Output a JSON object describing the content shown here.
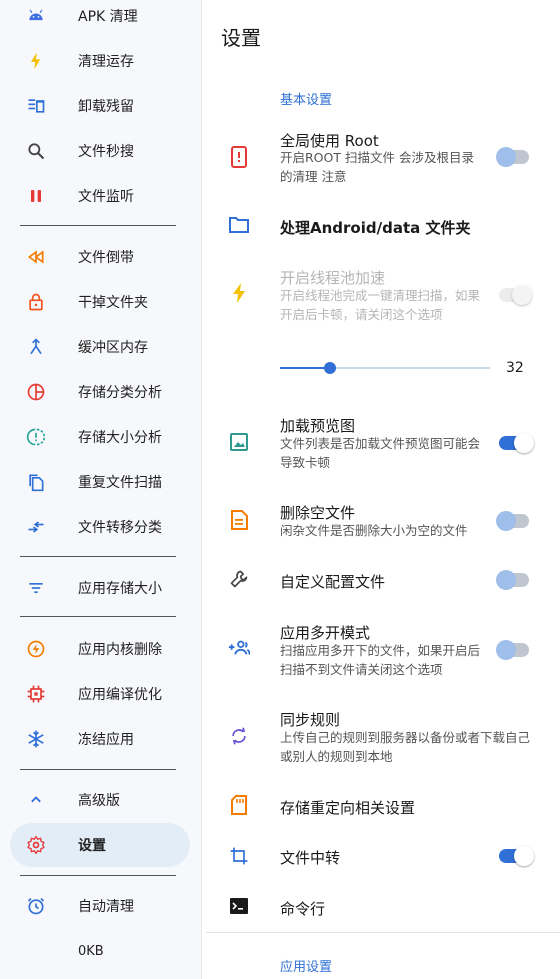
{
  "sidebar": {
    "items": [
      {
        "label": "APK 清理",
        "icon": "android-icon",
        "color": "#3d6fe0"
      },
      {
        "label": "清理运存",
        "icon": "lightning-icon",
        "color": "#f2c200"
      },
      {
        "label": "卸载残留",
        "icon": "uninstall-icon",
        "color": "#2f6fd6"
      },
      {
        "label": "文件秒搜",
        "icon": "search-icon",
        "color": "#444444"
      },
      {
        "label": "文件监听",
        "icon": "pause-icon",
        "color": "#e53935"
      },
      {
        "label": "文件倒带",
        "icon": "rewind-icon",
        "color": "#f57c00"
      },
      {
        "label": "干掉文件夹",
        "icon": "lock-icon",
        "color": "#f4511e"
      },
      {
        "label": "缓冲区内存",
        "icon": "merge-icon",
        "color": "#2f6fd6"
      },
      {
        "label": "存储分类分析",
        "icon": "pie-chart-icon",
        "color": "#e53935"
      },
      {
        "label": "存储大小分析",
        "icon": "data-usage-icon",
        "color": "#26a69a"
      },
      {
        "label": "重复文件扫描",
        "icon": "copy-icon",
        "color": "#2f6fd6"
      },
      {
        "label": "文件转移分类",
        "icon": "transfer-icon",
        "color": "#2f6fd6"
      },
      {
        "label": "应用存储大小",
        "icon": "filter-icon",
        "color": "#2f6fd6"
      },
      {
        "label": "应用内核删除",
        "icon": "power-bolt-icon",
        "color": "#f57c00"
      },
      {
        "label": "应用编译优化",
        "icon": "chip-icon",
        "color": "#e53935"
      },
      {
        "label": "冻结应用",
        "icon": "snowflake-icon",
        "color": "#2f6fd6"
      },
      {
        "label": "高级版",
        "icon": "chevron-up-icon",
        "color": "#2f6fd6"
      },
      {
        "label": "设置",
        "icon": "gear-icon",
        "color": "#e53935",
        "active": true
      },
      {
        "label": "自动清理",
        "icon": "alarm-icon",
        "color": "#2f6fd6"
      },
      {
        "label": "0KB",
        "icon": "",
        "color": "#222222"
      }
    ]
  },
  "main": {
    "page_title": "设置",
    "section_basic": "基本设置",
    "section_app": "应用设置",
    "rows": {
      "root": {
        "title": "全局使用 Root",
        "subtitle": "开启ROOT 扫描文件 会涉及根目录的清理 注意",
        "icon": "phone-alert-icon",
        "switch": false
      },
      "android_data": {
        "title": "处理Android/data 文件夹",
        "icon": "folder-icon"
      },
      "thread_pool": {
        "title": "开启线程池加速",
        "subtitle": "开启线程池完成一键清理扫描，如果开启后卡顿，请关闭这个选项",
        "icon": "lightning-icon",
        "switch": true,
        "disabled": true
      },
      "slider": {
        "value": "32",
        "fraction": 0.24
      },
      "preview": {
        "title": "加载预览图",
        "subtitle": "文件列表是否加载文件预览图可能会导致卡顿",
        "icon": "image-icon",
        "switch": true
      },
      "delete_empty": {
        "title": "删除空文件",
        "subtitle": "闲杂文件是否删除大小为空的文件",
        "icon": "document-icon",
        "switch": false
      },
      "custom_config": {
        "title": "自定义配置文件",
        "icon": "wrench-icon",
        "switch": false
      },
      "multi_open": {
        "title": "应用多开模式",
        "subtitle": "扫描应用多开下的文件，如果开启后扫描不到文件请关闭这个选项",
        "icon": "group-add-icon",
        "switch": false
      },
      "sync_rules": {
        "title": "同步规则",
        "subtitle": "上传自己的规则到服务器以备份或者下载自己或别人的规则到本地",
        "icon": "sync-icon"
      },
      "storage_redirect": {
        "title": "存储重定向相关设置",
        "icon": "sd-card-icon"
      },
      "file_transfer": {
        "title": "文件中转",
        "icon": "crop-icon",
        "switch": true
      },
      "command_line": {
        "title": "命令行",
        "icon": "terminal-icon"
      }
    }
  }
}
